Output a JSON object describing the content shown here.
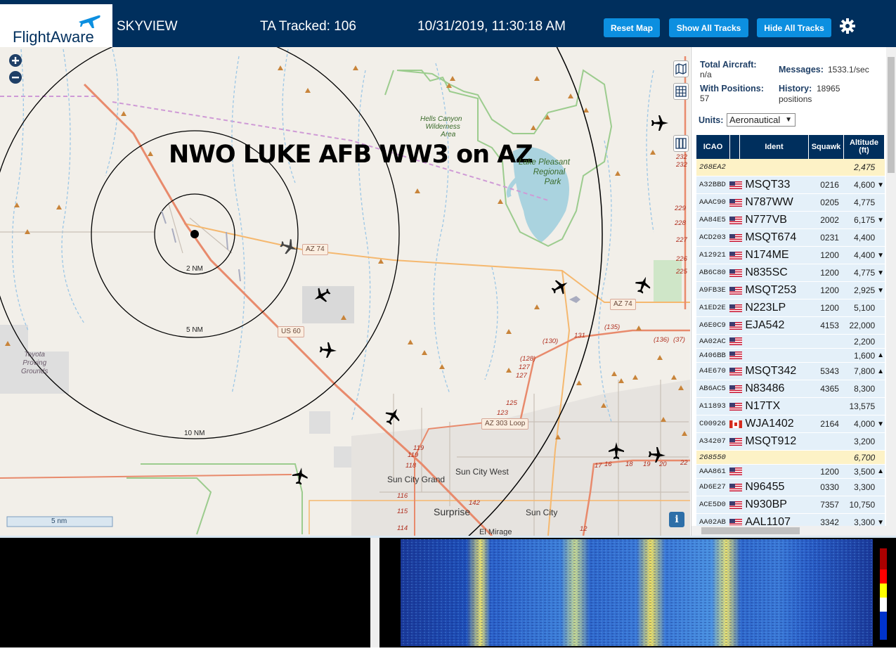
{
  "header": {
    "logo_text": "FlightAware",
    "app_name": "SKYVIEW",
    "tracked_label": "TA Tracked: 106",
    "datetime": "10/31/2019, 11:30:18 AM",
    "buttons": {
      "reset_map": "Reset Map",
      "show_all_tracks": "Show All Tracks",
      "hide_all_tracks": "Hide All Tracks"
    },
    "settings_icon": "gear-icon"
  },
  "map": {
    "overlay_title": "NWO LUKE AFB WW3 on AZ",
    "range_rings": [
      "2 NM",
      "5 NM",
      "10 NM"
    ],
    "place_labels": {
      "hells_canyon": [
        "Hells Canyon",
        "Wilderness",
        "Area"
      ],
      "lake_pleasant": [
        "Lake Pleasant",
        "Regional",
        "Park"
      ],
      "toyota": [
        "Toyota",
        "Proving",
        "Grounds"
      ],
      "sun_city_west": "Sun City West",
      "sun_city_grand": "Sun City Grand",
      "surprise": "Surprise",
      "sun_city": "Sun City",
      "el_mirage": "El Mirage"
    },
    "road_shields": {
      "az74_a": "AZ 74",
      "az74_b": "AZ 74",
      "us60": "US 60",
      "az303": "AZ 303 Loop"
    },
    "road_numbers": {
      "n232a": "232",
      "n232b": "232",
      "n229": "229",
      "n228": "228",
      "n227": "227",
      "n226": "226",
      "n225": "225",
      "n135": "(135)",
      "n136": "(136)",
      "n37": "(37)",
      "n130": "(130)",
      "n131": "131",
      "n128": "(128)",
      "n127a": "127",
      "n127b": "127",
      "n125": "125",
      "n123": "123",
      "n119a": "119",
      "n119b": "119",
      "n118": "118",
      "n116": "116",
      "n115": "115",
      "n114": "114",
      "n142": "142",
      "n17": "17",
      "n16": "16",
      "n18": "18",
      "n19": "19",
      "n20": "20",
      "n22": "22",
      "n12": "12"
    },
    "scale_label": "5 nm",
    "controls": {
      "zoom_in": "plus-icon",
      "zoom_out": "minus-icon",
      "map_layers": "map-icon",
      "grid": "grid-icon",
      "columns": "columns-icon",
      "info": "info-icon"
    },
    "info_glyph": "i"
  },
  "panel": {
    "total_aircraft_label": "Total Aircraft:",
    "total_aircraft_value": "n/a",
    "with_positions_label": "With Positions:",
    "with_positions_value": "57",
    "messages_label": "Messages:",
    "messages_value": "1533.1/sec",
    "history_label": "History:",
    "history_value": "18965",
    "history_unit": "positions",
    "units_label": "Units:",
    "units_value": "Aeronautical",
    "table": {
      "columns": [
        "ICAO",
        "Ident",
        "Squawk",
        "Altitude (ft)"
      ],
      "rows": [
        {
          "icao": "268EA2",
          "flag": "",
          "ident": "",
          "squawk": "",
          "alt": "2,475",
          "arrow": "",
          "highlight": true
        },
        {
          "icao": "A32BBD",
          "flag": "us",
          "ident": "MSQT33",
          "squawk": "0216",
          "alt": "4,600",
          "arrow": "▼"
        },
        {
          "icao": "AAAC90",
          "flag": "us",
          "ident": "N787WW",
          "squawk": "0205",
          "alt": "4,775",
          "arrow": ""
        },
        {
          "icao": "AA84E5",
          "flag": "us",
          "ident": "N777VB",
          "squawk": "2002",
          "alt": "6,175",
          "arrow": "▼"
        },
        {
          "icao": "ACD203",
          "flag": "us",
          "ident": "MSQT674",
          "squawk": "0231",
          "alt": "4,400",
          "arrow": ""
        },
        {
          "icao": "A12921",
          "flag": "us",
          "ident": "N174ME",
          "squawk": "1200",
          "alt": "4,400",
          "arrow": "▼"
        },
        {
          "icao": "AB6C80",
          "flag": "us",
          "ident": "N835SC",
          "squawk": "1200",
          "alt": "4,775",
          "arrow": "▼"
        },
        {
          "icao": "A9FB3E",
          "flag": "us",
          "ident": "MSQT253",
          "squawk": "1200",
          "alt": "2,925",
          "arrow": "▼"
        },
        {
          "icao": "A1ED2E",
          "flag": "us",
          "ident": "N223LP",
          "squawk": "1200",
          "alt": "5,100",
          "arrow": ""
        },
        {
          "icao": "A6E0C9",
          "flag": "us",
          "ident": "EJA542",
          "squawk": "4153",
          "alt": "22,000",
          "arrow": ""
        },
        {
          "icao": "AA02AC",
          "flag": "us",
          "ident": "",
          "squawk": "",
          "alt": "2,200",
          "arrow": "",
          "small": true
        },
        {
          "icao": "A406BB",
          "flag": "us",
          "ident": "",
          "squawk": "",
          "alt": "1,600",
          "arrow": "▲",
          "small": true
        },
        {
          "icao": "A4E670",
          "flag": "us",
          "ident": "MSQT342",
          "squawk": "5343",
          "alt": "7,800",
          "arrow": "▲"
        },
        {
          "icao": "AB6AC5",
          "flag": "us",
          "ident": "N83486",
          "squawk": "4365",
          "alt": "8,300",
          "arrow": ""
        },
        {
          "icao": "A11893",
          "flag": "us",
          "ident": "N17TX",
          "squawk": "",
          "alt": "13,575",
          "arrow": ""
        },
        {
          "icao": "C00926",
          "flag": "ca",
          "ident": "WJA1402",
          "squawk": "2164",
          "alt": "4,000",
          "arrow": "▼"
        },
        {
          "icao": "A34207",
          "flag": "us",
          "ident": "MSQT912",
          "squawk": "",
          "alt": "3,200",
          "arrow": ""
        },
        {
          "icao": "268550",
          "flag": "",
          "ident": "",
          "squawk": "",
          "alt": "6,700",
          "arrow": "",
          "highlight": true,
          "small": true
        },
        {
          "icao": "AAA861",
          "flag": "us",
          "ident": "",
          "squawk": "1200",
          "alt": "3,500",
          "arrow": "▲",
          "small": true
        },
        {
          "icao": "AD6E27",
          "flag": "us",
          "ident": "N96455",
          "squawk": "0330",
          "alt": "3,300",
          "arrow": ""
        },
        {
          "icao": "ACE5D0",
          "flag": "us",
          "ident": "N930BP",
          "squawk": "7357",
          "alt": "10,750",
          "arrow": ""
        },
        {
          "icao": "AA02AB",
          "flag": "us",
          "ident": "AAL1107",
          "squawk": "3342",
          "alt": "3,300",
          "arrow": "▼"
        }
      ]
    }
  },
  "colors": {
    "header_bg": "#002f5d",
    "button_bg": "#0c8fe0",
    "map_bg": "#f2efe9",
    "row_highlight": "#fdf2c6",
    "row_normal": "#e4f0f9"
  }
}
